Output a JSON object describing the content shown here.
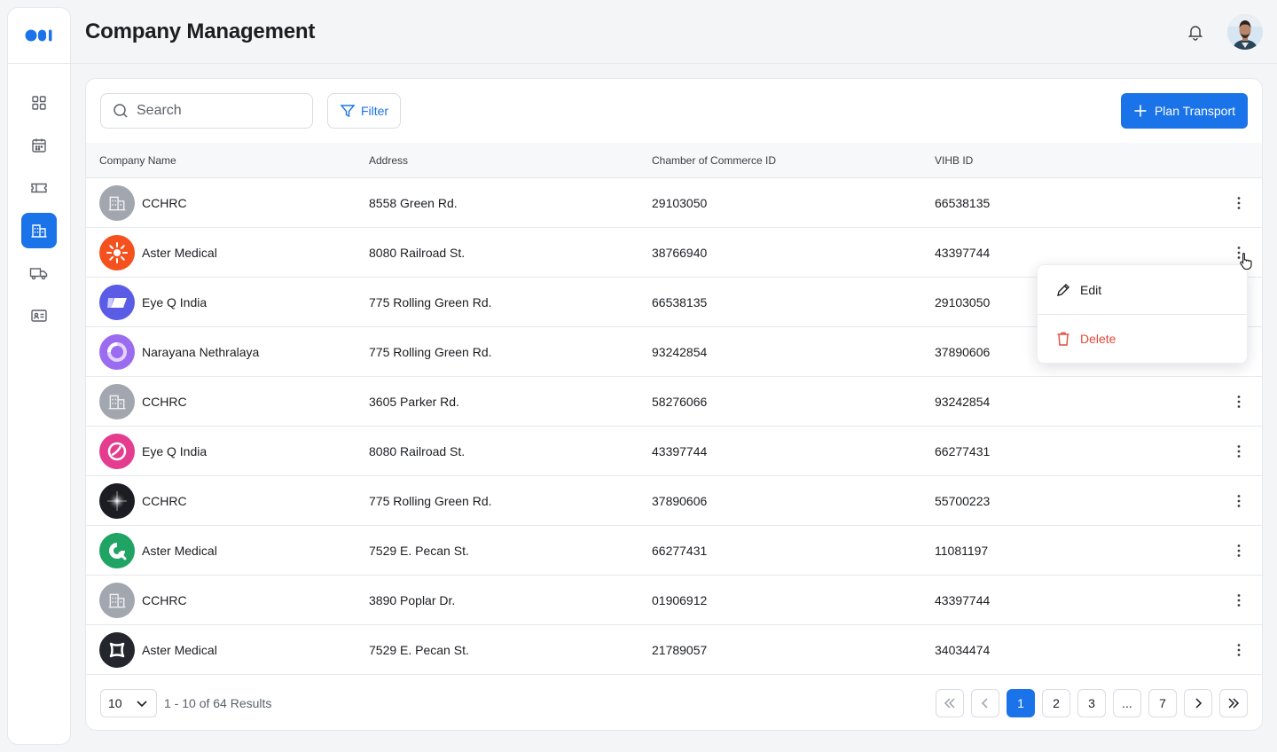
{
  "header": {
    "title": "Company Management"
  },
  "sidebar": {
    "items": [
      "dashboard",
      "calendar",
      "ticket",
      "companies",
      "truck",
      "id-card"
    ],
    "active_index": 3
  },
  "toolbar": {
    "search_placeholder": "Search",
    "filter_label": "Filter",
    "primary_label": "Plan Transport"
  },
  "table": {
    "columns": [
      "Company Name",
      "Address",
      "Chamber of Commerce ID",
      "VIHB ID"
    ],
    "rows": [
      {
        "name": "CCHRC",
        "address": "8558 Green Rd.",
        "coc": "29103050",
        "vihb": "66538135",
        "logo": "building"
      },
      {
        "name": "Aster Medical",
        "address": "8080 Railroad St.",
        "coc": "38766940",
        "vihb": "43397744",
        "logo": "sun"
      },
      {
        "name": "Eye Q India",
        "address": "775 Rolling Green Rd.",
        "coc": "66538135",
        "vihb": "29103050",
        "logo": "wave"
      },
      {
        "name": "Narayana Nethralaya",
        "address": "775 Rolling Green Rd.",
        "coc": "93242854",
        "vihb": "37890606",
        "logo": "ring"
      },
      {
        "name": "CCHRC",
        "address": "3605 Parker Rd.",
        "coc": "58276066",
        "vihb": "93242854",
        "logo": "building"
      },
      {
        "name": "Eye Q India",
        "address": "8080 Railroad St.",
        "coc": "43397744",
        "vihb": "66277431",
        "logo": "swirl"
      },
      {
        "name": "CCHRC",
        "address": "775 Rolling Green Rd.",
        "coc": "37890606",
        "vihb": "55700223",
        "logo": "star"
      },
      {
        "name": "Aster Medical",
        "address": "7529 E. Pecan St.",
        "coc": "66277431",
        "vihb": "11081197",
        "logo": "leaf"
      },
      {
        "name": "CCHRC",
        "address": "3890 Poplar Dr.",
        "coc": "01906912",
        "vihb": "43397744",
        "logo": "building"
      },
      {
        "name": "Aster Medical",
        "address": "7529 E. Pecan St.",
        "coc": "21789057",
        "vihb": "34034474",
        "logo": "cross"
      }
    ]
  },
  "context_menu": {
    "edit_label": "Edit",
    "delete_label": "Delete"
  },
  "footer": {
    "per_page": "10",
    "results": "1 - 10 of 64 Results",
    "pages": [
      "1",
      "2",
      "3",
      "...",
      "7"
    ],
    "current_page": "1"
  },
  "colors": {
    "accent": "#1a73e8",
    "danger": "#e5483a"
  }
}
